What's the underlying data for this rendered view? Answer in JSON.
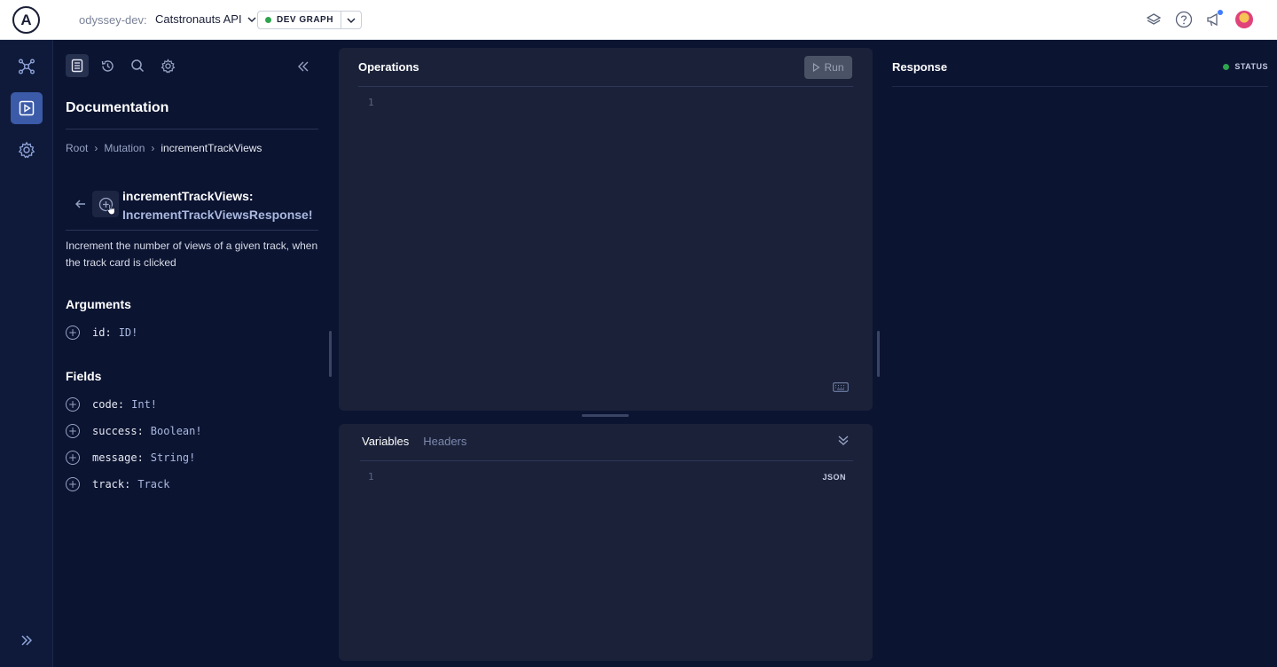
{
  "topbar": {
    "logo_letter": "A",
    "org": "odyssey-dev:",
    "graph": "Catstronauts API",
    "variant": "DEV GRAPH"
  },
  "docs": {
    "title": "Documentation",
    "breadcrumb": [
      "Root",
      "Mutation",
      "incrementTrackViews"
    ],
    "field_name": "incrementTrackViews:",
    "field_type": "IncrementTrackViewsResponse!",
    "description": "Increment the number of views of a given track, when the track card is clicked",
    "arguments_title": "Arguments",
    "arguments": [
      {
        "name": "id:",
        "type": "ID!"
      }
    ],
    "fields_title": "Fields",
    "fields": [
      {
        "name": "code:",
        "type": "Int!"
      },
      {
        "name": "success:",
        "type": "Boolean!"
      },
      {
        "name": "message:",
        "type": "String!"
      },
      {
        "name": "track:",
        "type": "Track"
      }
    ]
  },
  "operations": {
    "title": "Operations",
    "run_label": "Run",
    "line_number": "1"
  },
  "variables": {
    "tabs": [
      "Variables",
      "Headers"
    ],
    "line_number": "1",
    "format_label": "JSON"
  },
  "response": {
    "title": "Response",
    "status_label": "STATUS"
  },
  "colors": {
    "background": "#0b1431",
    "panel": "#1a2139",
    "rail_active": "#3b5aa8",
    "status_green": "#2ea44f"
  }
}
